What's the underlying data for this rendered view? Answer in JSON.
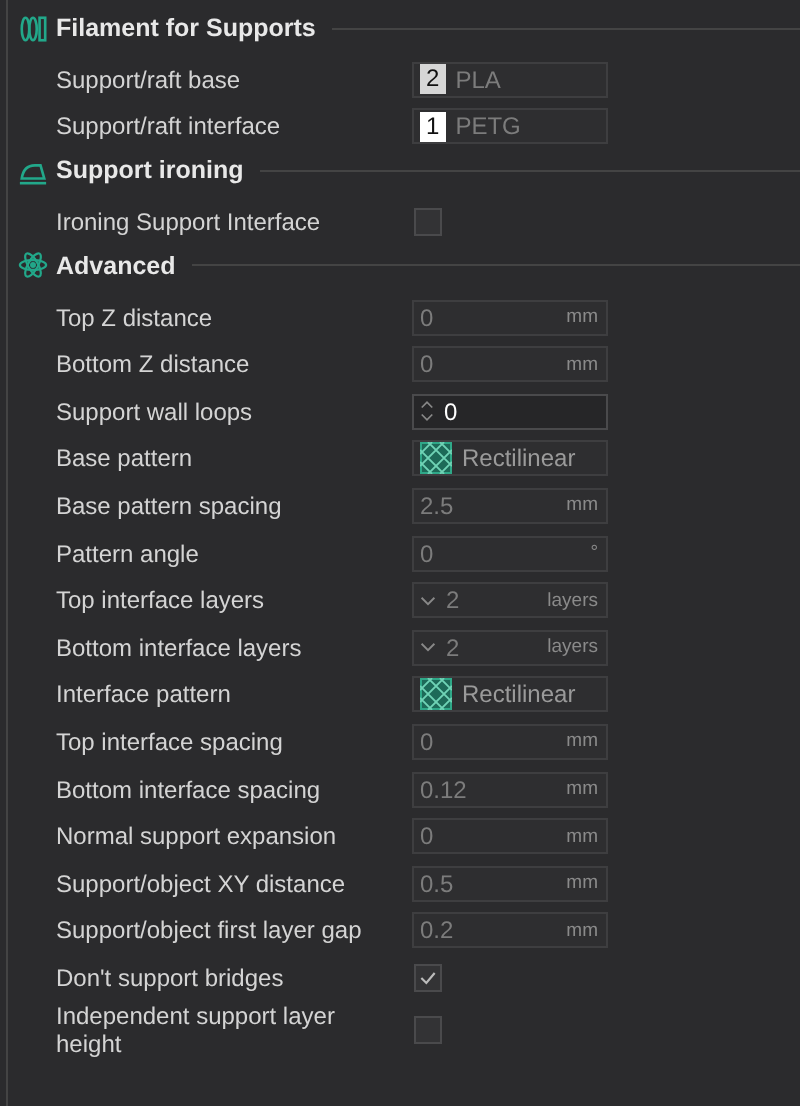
{
  "sections": [
    {
      "title": "Filament for Supports",
      "kind": "filament",
      "rows": [
        {
          "kind": "filament",
          "label": "Support/raft base",
          "number": "2",
          "color": "#d6d6d6",
          "value": "PLA"
        },
        {
          "kind": "filament",
          "label": "Support/raft interface",
          "number": "1",
          "color": "#ffffff",
          "value": "PETG"
        }
      ]
    },
    {
      "title": "Support ironing",
      "kind": "iron",
      "rows": [
        {
          "kind": "checkbox",
          "label": "Ironing Support Interface",
          "checked": false
        }
      ]
    },
    {
      "title": "Advanced",
      "kind": "atom",
      "rows": [
        {
          "kind": "number",
          "label": "Top Z distance",
          "value": "0",
          "unit": "mm"
        },
        {
          "kind": "number",
          "label": "Bottom Z distance",
          "value": "0",
          "unit": "mm"
        },
        {
          "kind": "spin",
          "label": "Support wall loops",
          "value": "0"
        },
        {
          "kind": "pattern",
          "label": "Base pattern",
          "value": "Rectilinear"
        },
        {
          "kind": "number",
          "label": "Base pattern spacing",
          "value": "2.5",
          "unit": "mm"
        },
        {
          "kind": "number",
          "label": "Pattern angle",
          "value": "0",
          "unit": "°"
        },
        {
          "kind": "combo",
          "label": "Top interface layers",
          "value": "2",
          "unit": "layers"
        },
        {
          "kind": "combo",
          "label": "Bottom interface layers",
          "value": "2",
          "unit": "layers"
        },
        {
          "kind": "pattern",
          "label": "Interface pattern",
          "value": "Rectilinear"
        },
        {
          "kind": "number",
          "label": "Top interface spacing",
          "value": "0",
          "unit": "mm"
        },
        {
          "kind": "number",
          "label": "Bottom interface spacing",
          "value": "0.12",
          "unit": "mm"
        },
        {
          "kind": "number",
          "label": "Normal support expansion",
          "value": "0",
          "unit": "mm"
        },
        {
          "kind": "number",
          "label": "Support/object XY distance",
          "value": "0.5",
          "unit": "mm"
        },
        {
          "kind": "number",
          "label": "Support/object first layer gap",
          "value": "0.2",
          "unit": "mm"
        },
        {
          "kind": "checkbox",
          "label": "Don't support bridges",
          "checked": true
        },
        {
          "kind": "checkbox",
          "label": "Independent support layer height",
          "checked": false
        }
      ]
    }
  ]
}
